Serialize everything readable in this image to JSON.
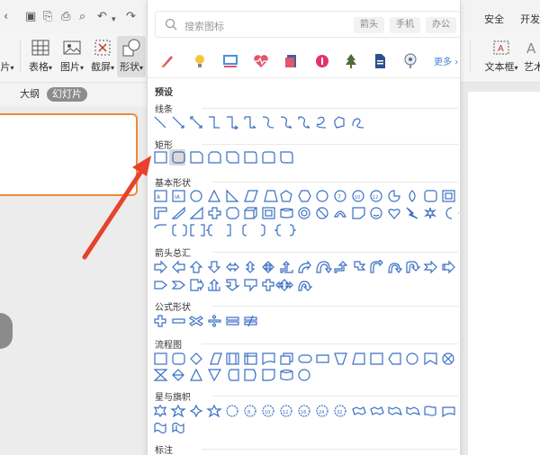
{
  "ribbon": {
    "tabs": [
      "安全",
      "开发"
    ],
    "buttons": [
      {
        "id": "pic-partial",
        "label": "片"
      },
      {
        "id": "table",
        "label": "表格"
      },
      {
        "id": "picture",
        "label": "图片"
      },
      {
        "id": "screenshot",
        "label": "截屏"
      },
      {
        "id": "shape",
        "label": "形状"
      },
      {
        "id": "textbox",
        "label": "文本框"
      },
      {
        "id": "art",
        "label": "艺术"
      }
    ]
  },
  "view_tabs": {
    "outline": "大纲",
    "slides": "幻灯片"
  },
  "panel": {
    "search_placeholder": "搜索图标",
    "chips": [
      "箭头",
      "手机",
      "办公"
    ],
    "more_label": "更多",
    "preset_label": "预设",
    "sections": [
      "线条",
      "矩形",
      "基本形状",
      "箭头总汇",
      "公式形状",
      "流程图",
      "星与旗帜",
      "标注"
    ]
  },
  "colors": {
    "accent": "#4a7fd6",
    "shape_stroke": "#3a6fc4",
    "annotation_arrow": "#e8412c",
    "slide_border": "#f08a3c"
  }
}
